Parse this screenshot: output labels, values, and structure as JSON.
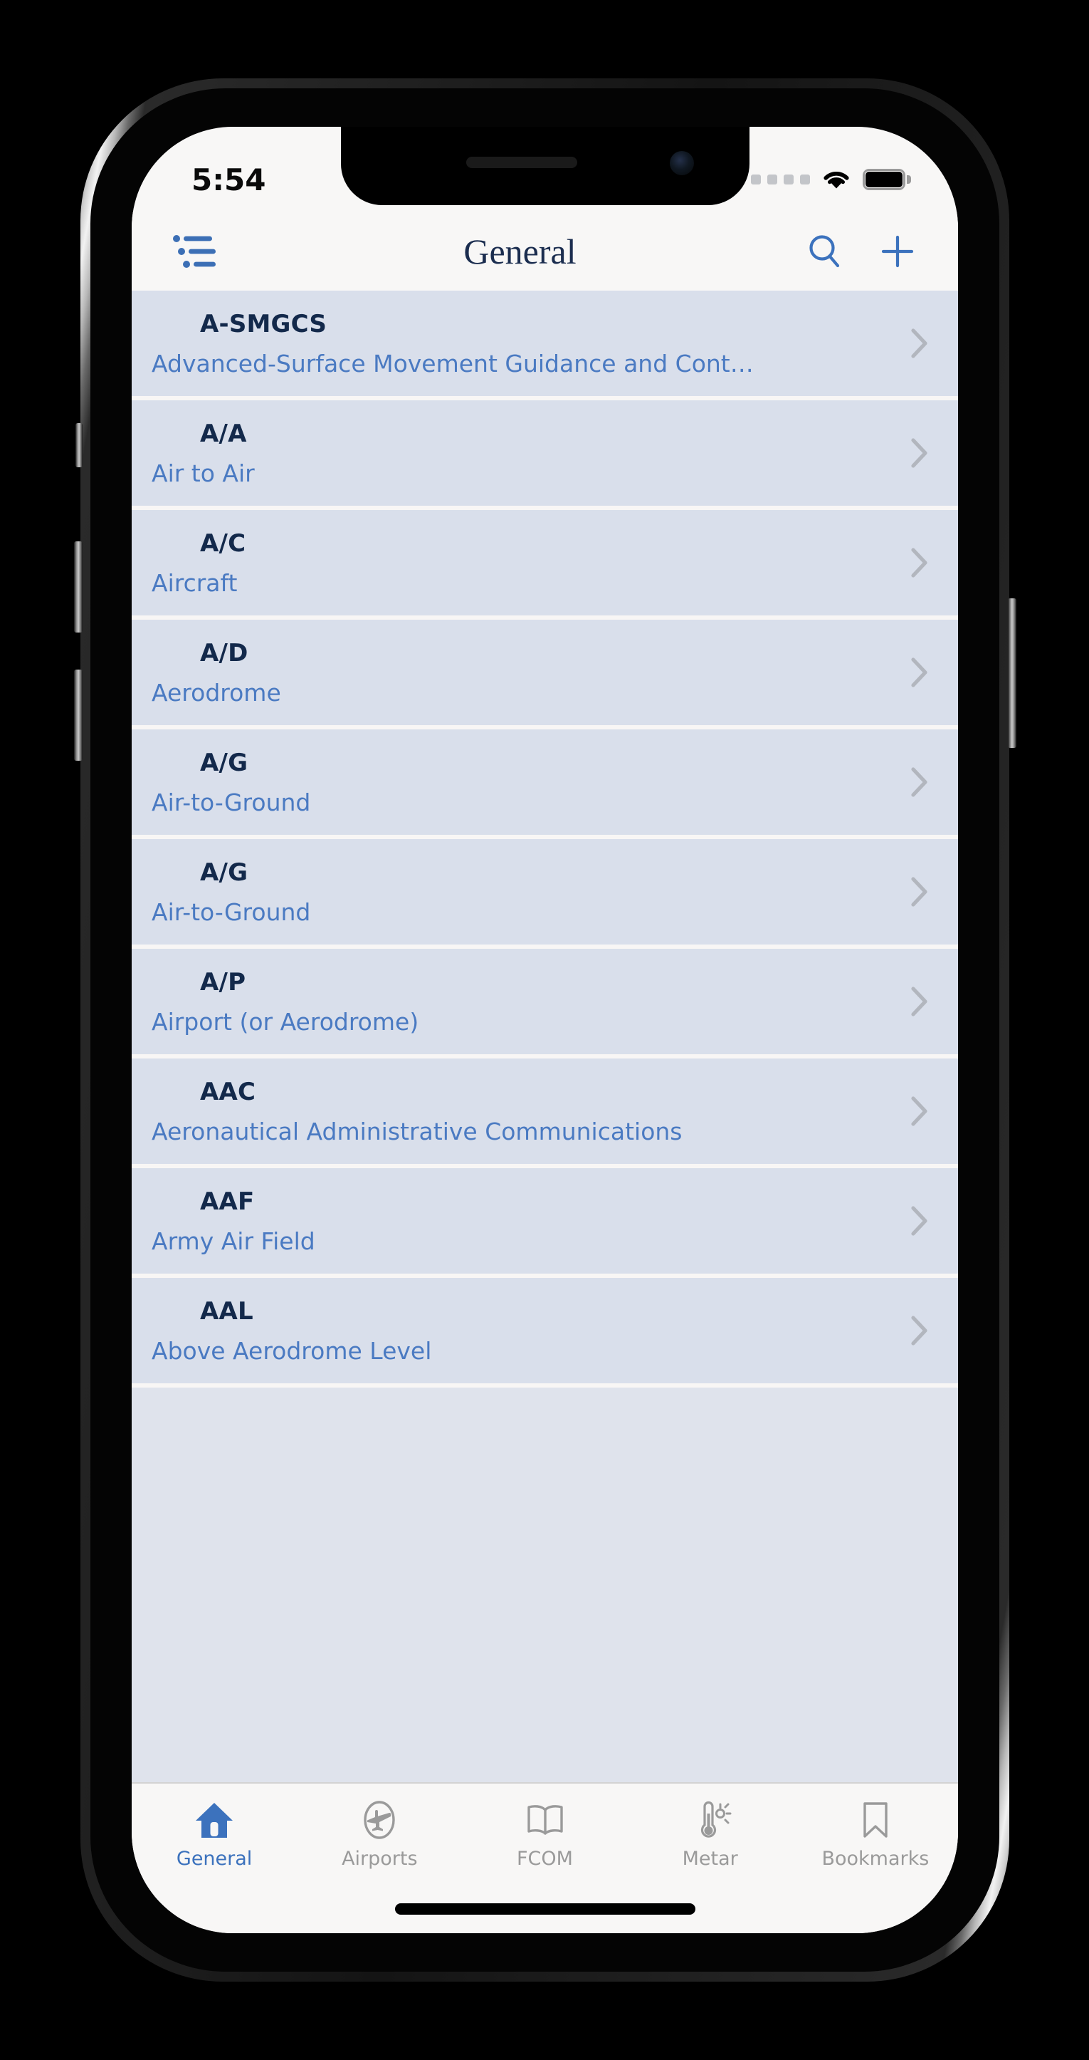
{
  "status_bar": {
    "time": "5:54",
    "signal_icon": "cellular-dots-icon",
    "wifi_icon": "wifi-icon",
    "battery_icon": "battery-full-icon"
  },
  "navbar": {
    "menu_icon": "list-menu-icon",
    "title": "General",
    "search_icon": "search-icon",
    "add_icon": "plus-icon"
  },
  "list": {
    "rows": [
      {
        "abbr": "A-SMGCS",
        "desc": "Advanced-Surface Movement Guidance and Cont…"
      },
      {
        "abbr": "A/A",
        "desc": "Air to Air"
      },
      {
        "abbr": "A/C",
        "desc": "Aircraft"
      },
      {
        "abbr": "A/D",
        "desc": "Aerodrome"
      },
      {
        "abbr": "A/G",
        "desc": "Air-to-Ground"
      },
      {
        "abbr": "A/G",
        "desc": "Air-to-Ground"
      },
      {
        "abbr": "A/P",
        "desc": "Airport (or Aerodrome)"
      },
      {
        "abbr": "AAC",
        "desc": "Aeronautical Administrative Communications"
      },
      {
        "abbr": "AAF",
        "desc": "Army Air Field"
      },
      {
        "abbr": "AAL",
        "desc": "Above Aerodrome Level"
      }
    ],
    "chevron_icon": "chevron-right-icon"
  },
  "tabbar": {
    "tabs": [
      {
        "label": "General",
        "icon": "home-icon",
        "active": true
      },
      {
        "label": "Airports",
        "icon": "airplane-icon",
        "active": false
      },
      {
        "label": "FCOM",
        "icon": "book-icon",
        "active": false
      },
      {
        "label": "Metar",
        "icon": "thermometer-sun-icon",
        "active": false
      },
      {
        "label": "Bookmarks",
        "icon": "bookmark-icon",
        "active": false
      }
    ]
  },
  "colors": {
    "accent_blue": "#3c72bd",
    "title_navy": "#1b2d4f",
    "abbr_navy": "#13294b",
    "desc_blue": "#4a7ac2",
    "row_bg": "#d9dfeb",
    "row_separator": "#f8f6f5",
    "chrome_bg": "#f8f7f6",
    "inactive_gray": "#9a9a9a"
  }
}
